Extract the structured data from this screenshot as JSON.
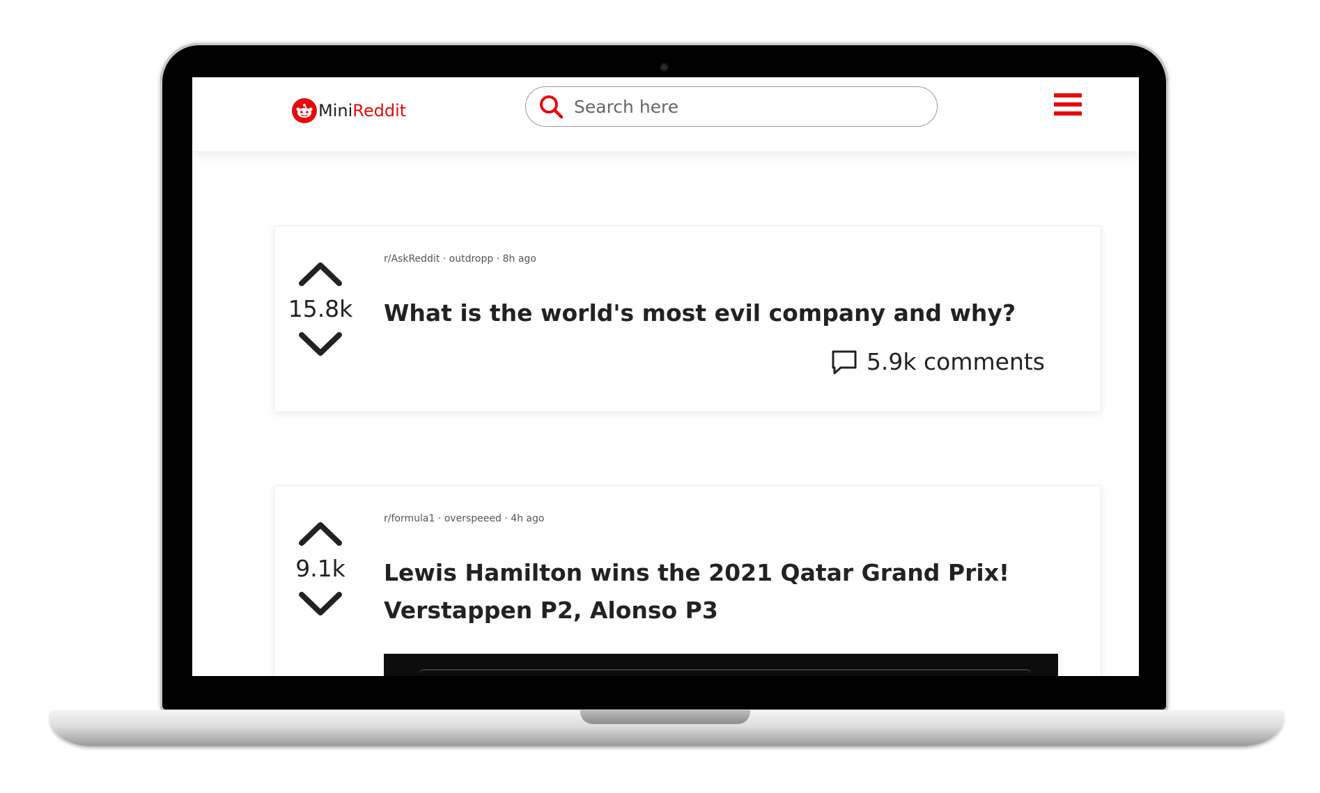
{
  "header": {
    "brand_mini": "Mini",
    "brand_reddit": "Reddit",
    "search_placeholder": "Search here"
  },
  "posts": [
    {
      "meta": "r/AskReddit · outdropp · 8h ago",
      "score": "15.8k",
      "title": "What is the world's most evil company and why?",
      "comments": "5.9k comments"
    },
    {
      "meta": "r/formula1 · overspeeed · 4h ago",
      "score": "9.1k",
      "title": "Lewis Hamilton wins the 2021 Qatar Grand Prix! Verstappen P2, Alonso P3"
    }
  ],
  "colors": {
    "brand": "#e50b0b",
    "text": "#222222",
    "border": "#9a9a9a"
  },
  "icons": [
    "reddit-logo-icon",
    "search-icon",
    "hamburger-menu-icon",
    "upvote-icon",
    "downvote-icon",
    "comment-icon"
  ]
}
